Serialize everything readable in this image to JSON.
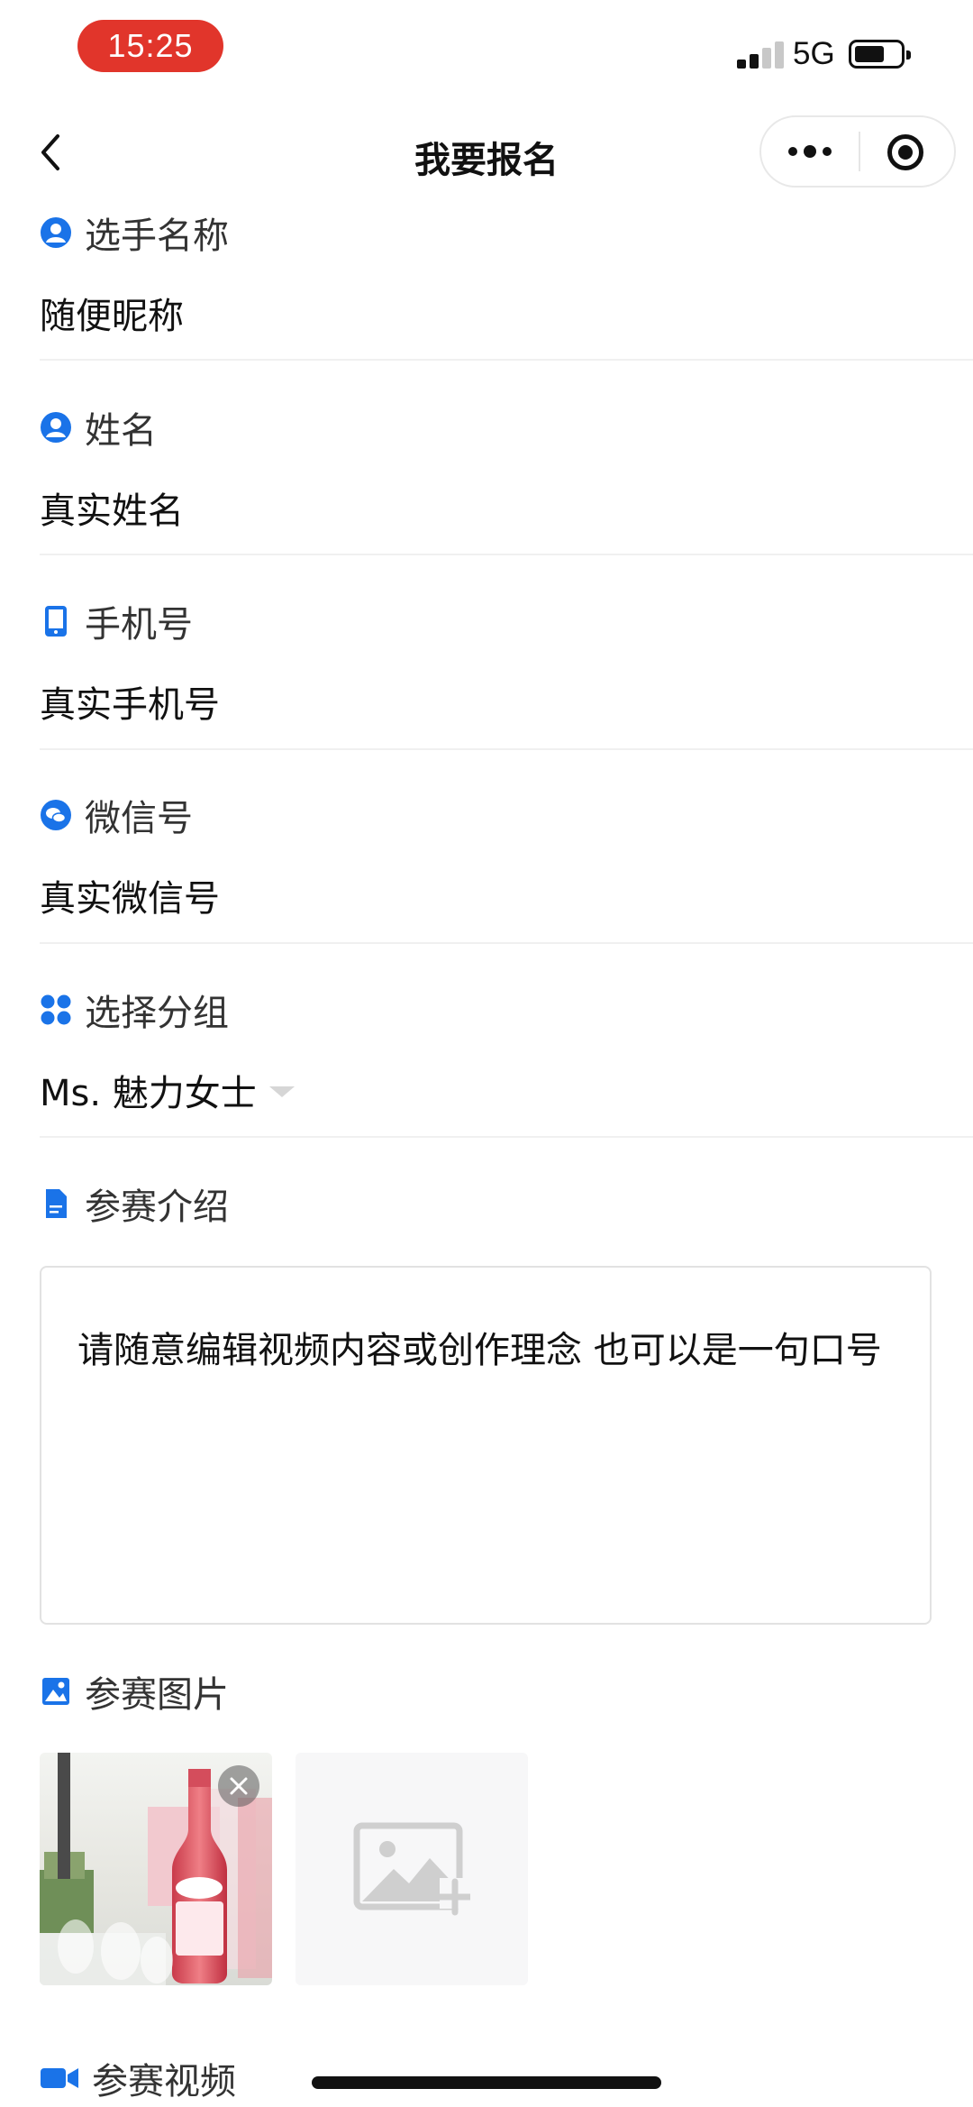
{
  "status_bar": {
    "time": "15:25",
    "network": "5G"
  },
  "nav": {
    "title": "我要报名"
  },
  "form": {
    "nickname": {
      "label": "选手名称",
      "value": "随便昵称"
    },
    "name": {
      "label": "姓名",
      "value": "真实姓名"
    },
    "phone": {
      "label": "手机号",
      "value": "真实手机号"
    },
    "wechat": {
      "label": "微信号",
      "value": "真实微信号"
    },
    "group": {
      "label": "选择分组",
      "value": "Ms. 魅力女士"
    },
    "intro": {
      "label": "参赛介绍",
      "value": "请随意编辑视频内容或创作理念 也可以是一句口号"
    },
    "images": {
      "label": "参赛图片"
    },
    "video": {
      "label": "参赛视频"
    }
  },
  "icons": {
    "accent": "#1a73e8",
    "nickname": "user-icon",
    "name": "user-icon",
    "phone": "phone-icon",
    "wechat": "wechat-icon",
    "group": "grid-icon",
    "intro": "document-icon",
    "images": "image-icon",
    "video": "video-camera-icon",
    "add_image": "add-image-icon"
  },
  "colors": {
    "time_pill": "#e1352b",
    "accent": "#1a73e8"
  }
}
